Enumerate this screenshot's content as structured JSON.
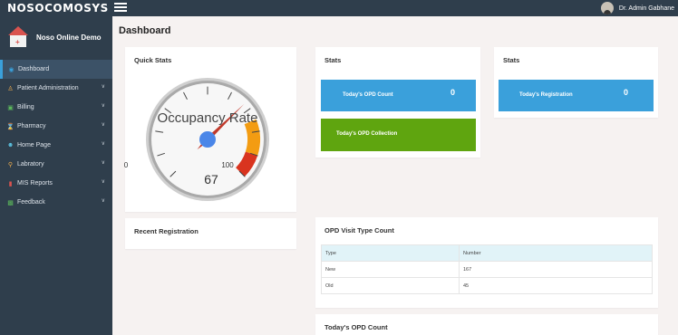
{
  "topbar": {
    "logo": "NOSOCOMOSYS",
    "user_name": "Dr. Admin Gabhane"
  },
  "sidebar": {
    "brand": "Noso Online Demo",
    "items": [
      {
        "label": "Dashboard",
        "icon": "dashboard-icon",
        "active": true,
        "chevron": false
      },
      {
        "label": "Patient Administration",
        "icon": "patients-icon",
        "chevron": true
      },
      {
        "label": "Billing",
        "icon": "billing-icon",
        "chevron": true
      },
      {
        "label": "Pharmacy",
        "icon": "hourglass-icon",
        "chevron": true
      },
      {
        "label": "Home Page",
        "icon": "user-icon",
        "chevron": true
      },
      {
        "label": "Labratory",
        "icon": "flask-icon",
        "chevron": true
      },
      {
        "label": "MIS Reports",
        "icon": "report-icon",
        "chevron": true
      },
      {
        "label": "Feedback",
        "icon": "feedback-icon",
        "chevron": true
      }
    ]
  },
  "main": {
    "title": "Dashboard",
    "quick_stats": {
      "title": "Quick Stats",
      "gauge": {
        "label": "Occupancy Rate",
        "value": 67,
        "min": 0,
        "max": 100
      }
    },
    "stats_left": {
      "title": "Stats",
      "opd_count_label": "Today's OPD Count",
      "opd_count_value": "0",
      "opd_collection_label": "Today's OPD Collection"
    },
    "stats_right": {
      "title": "Stats",
      "registration_label": "Today's Registration",
      "registration_value": "0"
    },
    "recent_registration": {
      "title": "Recent Registration"
    },
    "opd_visit": {
      "title": "OPD Visit Type Count",
      "headers": [
        "Type",
        "Number"
      ],
      "rows": [
        [
          "New",
          "167"
        ],
        [
          "Old",
          "45"
        ]
      ]
    },
    "todays_opd_count": {
      "title": "Today's OPD Count"
    }
  },
  "colors": {
    "sidebar": "#2f3e4c",
    "blue": "#3aa0db",
    "green": "#5fa50f",
    "background": "#f6f2f1"
  }
}
